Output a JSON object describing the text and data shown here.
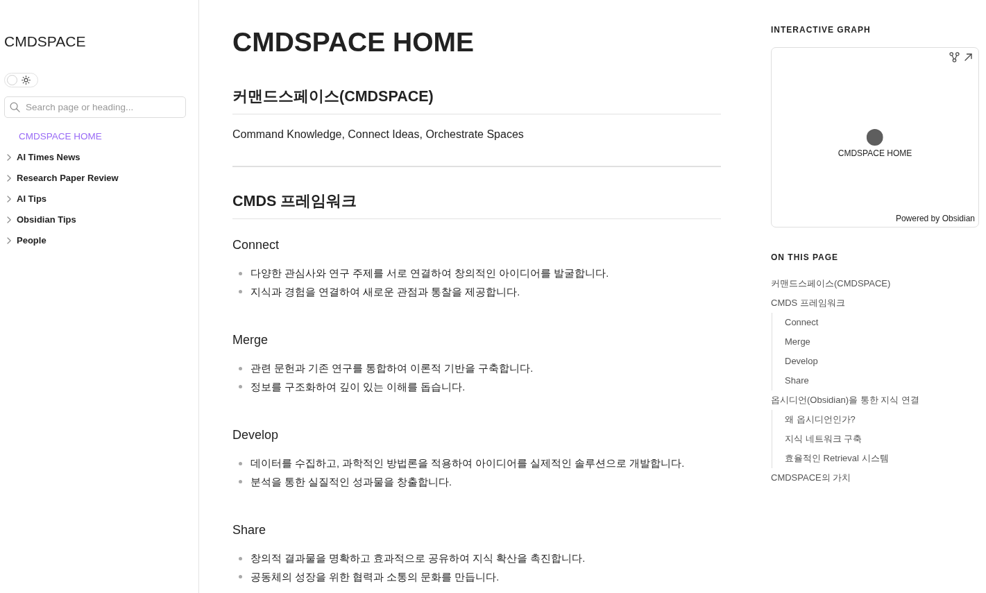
{
  "sidebar": {
    "title": "CMDSPACE",
    "theme_toggle": {
      "on": false
    },
    "search": {
      "placeholder": "Search page or heading..."
    },
    "items": [
      {
        "kind": "page",
        "label": "CMDSPACE HOME",
        "selected": true
      },
      {
        "kind": "folder",
        "label": "AI Times News",
        "selected": false,
        "expanded": false
      },
      {
        "kind": "folder",
        "label": "Research Paper Review",
        "selected": false,
        "expanded": false
      },
      {
        "kind": "folder",
        "label": "AI Tips",
        "selected": false,
        "expanded": false
      },
      {
        "kind": "folder",
        "label": "Obsidian Tips",
        "selected": false,
        "expanded": false
      },
      {
        "kind": "folder",
        "label": "People",
        "selected": false,
        "expanded": false
      }
    ]
  },
  "main": {
    "title": "CMDSPACE HOME",
    "blocks": [
      {
        "kind": "heading2",
        "text": "커맨드스페이스(CMDSPACE)"
      },
      {
        "kind": "paragraph",
        "text": "Command Knowledge, Connect Ideas, Orchestrate Spaces"
      },
      {
        "kind": "divider"
      },
      {
        "kind": "heading2",
        "text": "CMDS 프레임워크"
      },
      {
        "kind": "heading3",
        "text": "Connect"
      },
      {
        "kind": "bullets",
        "items": [
          "다양한 관심사와 연구 주제를 서로 연결하여 창의적인 아이디어를 발굴합니다.",
          "지식과 경험을 연결하여 새로운 관점과 통찰을 제공합니다."
        ]
      },
      {
        "kind": "heading3",
        "text": "Merge"
      },
      {
        "kind": "bullets",
        "items": [
          "관련 문헌과 기존 연구를 통합하여 이론적 기반을 구축합니다.",
          "정보를 구조화하여 깊이 있는 이해를 돕습니다."
        ]
      },
      {
        "kind": "heading3",
        "text": "Develop"
      },
      {
        "kind": "bullets",
        "items": [
          "데이터를 수집하고, 과학적인 방법론을 적용하여 아이디어를 실제적인 솔루션으로 개발합니다.",
          "분석을 통한 실질적인 성과물을 창출합니다."
        ]
      },
      {
        "kind": "heading3",
        "text": "Share"
      },
      {
        "kind": "bullets",
        "items": [
          "창의적 결과물을 명확하고 효과적으로 공유하여 지식 확산을 촉진합니다.",
          "공동체의 성장을 위한 협력과 소통의 문화를 만듭니다."
        ]
      }
    ]
  },
  "graph": {
    "title": "INTERACTIVE GRAPH",
    "nodes": [
      {
        "label": "CMDSPACE HOME"
      }
    ],
    "credit": "Powered by Obsidian"
  },
  "toc": {
    "title": "ON THIS PAGE",
    "items": [
      {
        "label": "커맨드스페이스(CMDSPACE)"
      },
      {
        "label": "CMDS 프레임워크",
        "children": [
          {
            "label": "Connect"
          },
          {
            "label": "Merge"
          },
          {
            "label": "Develop"
          },
          {
            "label": "Share"
          }
        ]
      },
      {
        "label": "옵시디언(Obsidian)을 통한 지식 연결",
        "children": [
          {
            "label": "왜 옵시디언인가?"
          },
          {
            "label": "지식 네트워크 구축"
          },
          {
            "label": "효율적인 Retrieval 시스템"
          }
        ]
      },
      {
        "label": "CMDSPACE의 가치"
      }
    ]
  }
}
